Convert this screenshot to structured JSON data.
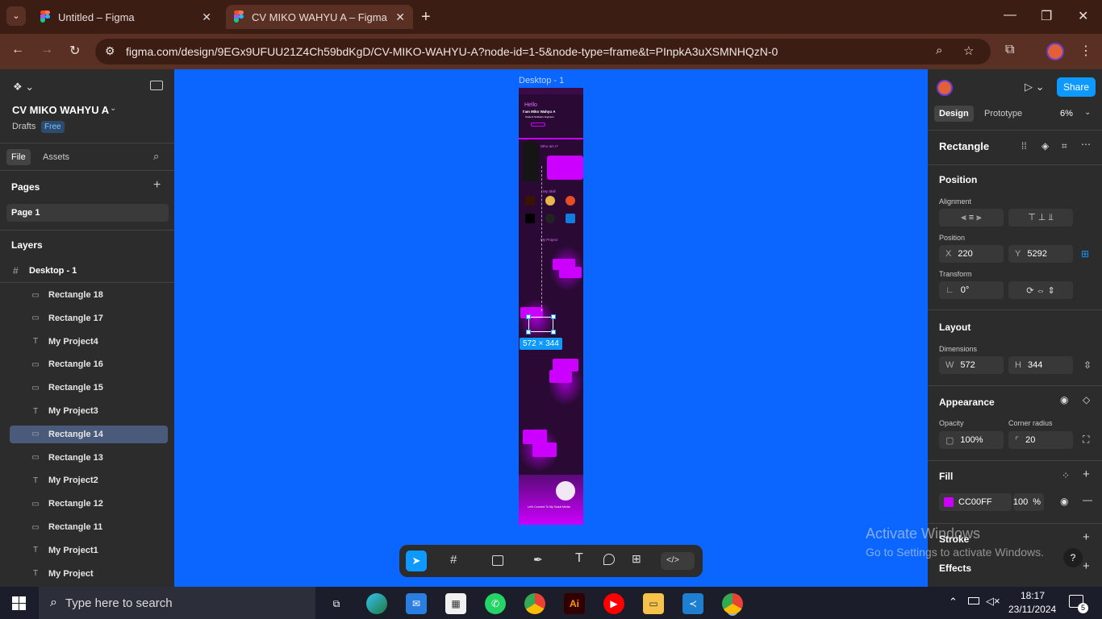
{
  "browser": {
    "tab1": "Untitled – Figma",
    "tab2": "CV MIKO WAHYU A – Figma",
    "url": "figma.com/design/9EGx9UFUU21Z4Ch59bdKgD/CV-MIKO-WAHYU-A?node-id=1-5&node-type=frame&t=PInpkA3uXSMNHQzN-0"
  },
  "left": {
    "file_title": "CV MIKO WAHYU A",
    "drafts": "Drafts",
    "plan": "Free",
    "tab_file": "File",
    "tab_assets": "Assets",
    "pages_label": "Pages",
    "page1": "Page 1",
    "layers_label": "Layers",
    "frame_layer": "Desktop - 1",
    "layers": [
      "Rectangle 18",
      "Rectangle 17",
      "My Project4",
      "Rectangle 16",
      "Rectangle 15",
      "My Project3",
      "Rectangle 14",
      "Rectangle 13",
      "My Project2",
      "Rectangle 12",
      "Rectangle 11",
      "My Project1",
      "My Project"
    ],
    "layer_types": [
      "rect",
      "rect",
      "text",
      "rect",
      "rect",
      "text",
      "rect",
      "rect",
      "text",
      "rect",
      "rect",
      "text",
      "text"
    ],
    "selected": "Rectangle 14"
  },
  "canvas": {
    "frame_label": "Desktop - 1",
    "size_badge": "572 × 344",
    "design_hello": "Hello",
    "design_name": "I'am Miko Wahyu A",
    "design_role": "Student Software Engineer",
    "design_who": "Who am I?",
    "design_skill": "My Skill",
    "design_project": "My Project",
    "design_connect": "Let's Connect To My Social Media"
  },
  "right": {
    "share": "Share",
    "tab_design": "Design",
    "tab_prototype": "Prototype",
    "zoom": "6%",
    "element": "Rectangle",
    "position": "Position",
    "alignment": "Alignment",
    "position_label": "Position",
    "x_label": "X",
    "x": "220",
    "y_label": "Y",
    "y": "5292",
    "transform": "Transform",
    "rotation": "0°",
    "layout": "Layout",
    "dimensions": "Dimensions",
    "w_label": "W",
    "w": "572",
    "h_label": "H",
    "h": "344",
    "appearance": "Appearance",
    "opacity_label": "Opacity",
    "opacity": "100%",
    "radius_label": "Corner radius",
    "radius": "20",
    "fill": "Fill",
    "fill_hex": "CC00FF",
    "fill_opacity": "100",
    "percent": "%",
    "stroke": "Stroke",
    "effects": "Effects"
  },
  "watermark": {
    "line1": "Activate Windows",
    "line2": "Go to Settings to activate Windows."
  },
  "taskbar": {
    "search": "Type here to search",
    "time": "18:17",
    "date": "23/11/2024",
    "notif": "5"
  },
  "colors": {
    "fill": "#cc00ff",
    "canvas": "#0a66ff",
    "accent": "#0d99ff"
  }
}
